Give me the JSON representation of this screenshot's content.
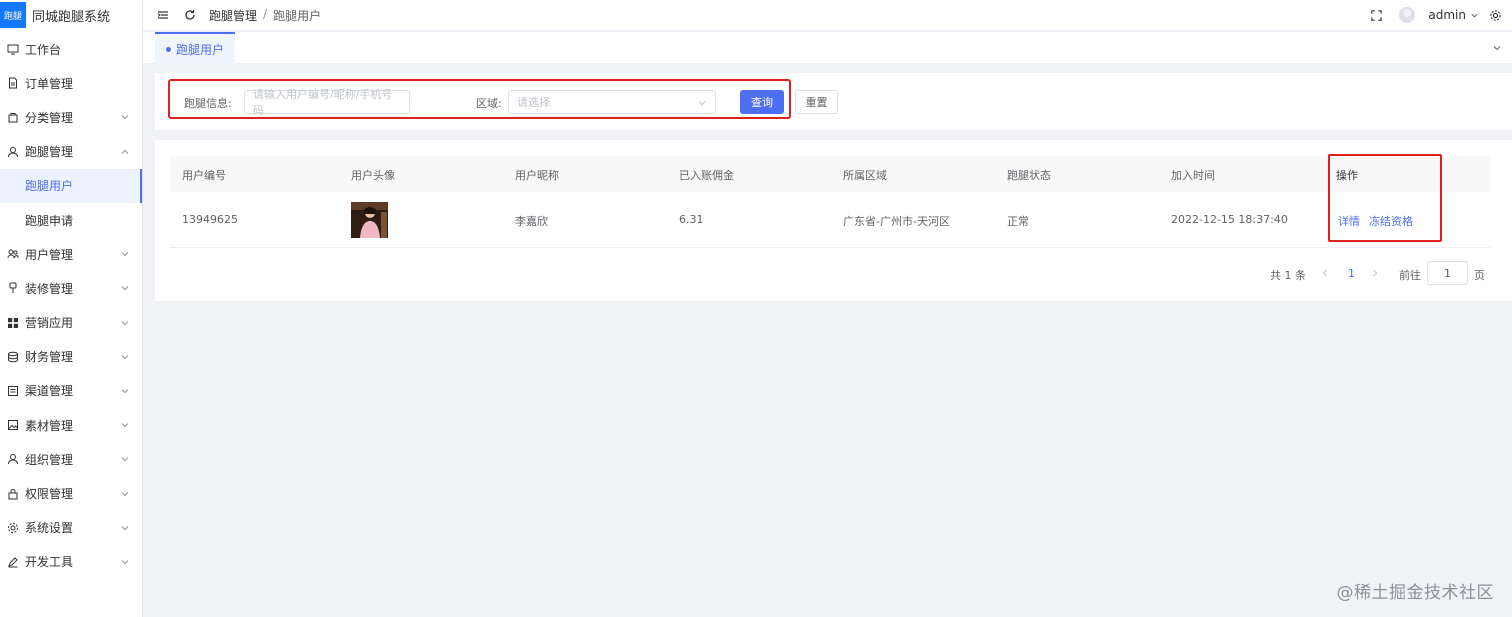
{
  "app": {
    "logo_badge": "跑腿",
    "title": "同城跑腿系统"
  },
  "sidebar": {
    "items": [
      {
        "label": "工作台",
        "icon": "monitor-icon",
        "has_chevron": false
      },
      {
        "label": "订单管理",
        "icon": "document-icon",
        "has_chevron": false
      },
      {
        "label": "分类管理",
        "icon": "bag-icon",
        "has_chevron": true
      },
      {
        "label": "跑腿管理",
        "icon": "person-icon",
        "has_chevron": true,
        "expanded": true
      }
    ],
    "sub_items": [
      {
        "label": "跑腿用户",
        "active": true
      },
      {
        "label": "跑腿申请",
        "active": false
      }
    ],
    "items_after": [
      {
        "label": "用户管理",
        "icon": "users-icon"
      },
      {
        "label": "装修管理",
        "icon": "brush-icon"
      },
      {
        "label": "营销应用",
        "icon": "grid-icon"
      },
      {
        "label": "财务管理",
        "icon": "coins-icon"
      },
      {
        "label": "渠道管理",
        "icon": "channel-icon"
      },
      {
        "label": "素材管理",
        "icon": "image-icon"
      },
      {
        "label": "组织管理",
        "icon": "person-icon"
      },
      {
        "label": "权限管理",
        "icon": "lock-icon"
      },
      {
        "label": "系统设置",
        "icon": "gear-icon"
      },
      {
        "label": "开发工具",
        "icon": "pen-icon"
      }
    ]
  },
  "header": {
    "breadcrumb": [
      "跑腿管理",
      "跑腿用户"
    ],
    "separator": "/",
    "username": "admin"
  },
  "tabs": [
    {
      "label": "跑腿用户",
      "active": true
    }
  ],
  "search": {
    "info_label": "跑腿信息:",
    "info_placeholder": "请输入用户编号/昵称/手机号码",
    "region_label": "区域:",
    "region_placeholder": "请选择",
    "query_button": "查询",
    "reset_button": "重置"
  },
  "table": {
    "columns": [
      "用户编号",
      "用户头像",
      "用户昵称",
      "已入账佣金",
      "所属区域",
      "跑腿状态",
      "加入时间",
      "操作"
    ],
    "rows": [
      {
        "id": "13949625",
        "nickname": "李嘉欣",
        "commission": "6.31",
        "region": "广东省-广州市-天河区",
        "status": "正常",
        "joined": "2022-12-15 18:37:40",
        "actions": [
          "详情",
          "冻结资格"
        ]
      }
    ]
  },
  "pagination": {
    "total": "共 1 条",
    "current_page": "1",
    "goto_label": "前往",
    "goto_value": "1",
    "page_suffix": "页"
  },
  "watermark": "@稀土掘金技术社区",
  "colors": {
    "primary": "#4e6ef2",
    "highlight_outline": "#e02020",
    "logo": "#1677ff"
  }
}
